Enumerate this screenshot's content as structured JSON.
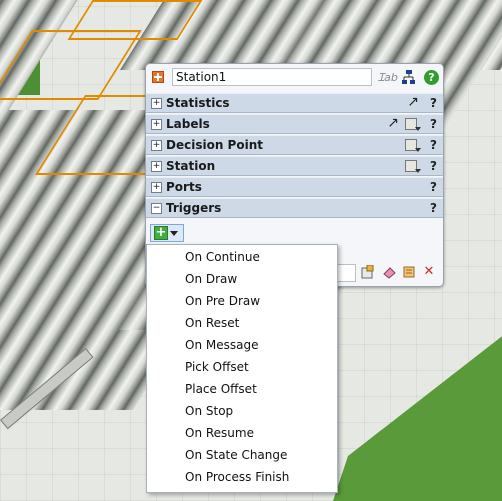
{
  "object": {
    "name": "Station1",
    "icon": "station-icon"
  },
  "title_tools": {
    "label_icon": "label-edit-icon",
    "tree_icon": "tree-icon",
    "help": "?"
  },
  "sections": [
    {
      "label": "Statistics",
      "expander": "+",
      "help": "?",
      "tools": [
        "pin-arrow-icon"
      ]
    },
    {
      "label": "Labels",
      "expander": "+",
      "help": "?",
      "tools": [
        "pin-arrow-icon",
        "settings-menu-icon"
      ]
    },
    {
      "label": "Decision Point",
      "expander": "+",
      "help": "?",
      "tools": [
        "settings-menu-icon"
      ]
    },
    {
      "label": "Station",
      "expander": "+",
      "help": "?",
      "tools": [
        "settings-menu-icon"
      ]
    },
    {
      "label": "Ports",
      "expander": "+",
      "help": "?",
      "tools": []
    },
    {
      "label": "Triggers",
      "expander": "−",
      "help": "?",
      "tools": []
    }
  ],
  "triggers": {
    "add_button": {
      "icon": "add-icon",
      "dropdown": "chevron-down-icon"
    },
    "menu": [
      "On Continue",
      "On Draw",
      "On Pre Draw",
      "On Reset",
      "On Message",
      "Pick Offset",
      "Place Offset",
      "On Stop",
      "On Resume",
      "On State Change",
      "On Process Finish"
    ],
    "row_tools": [
      "edit-icon",
      "erase-icon",
      "script-icon",
      "delete-icon"
    ]
  },
  "colors": {
    "header": "#cdd9e6",
    "accent_orange": "#e08a00",
    "help_green": "#2f9e2f",
    "delete_red": "#d42a2a"
  }
}
